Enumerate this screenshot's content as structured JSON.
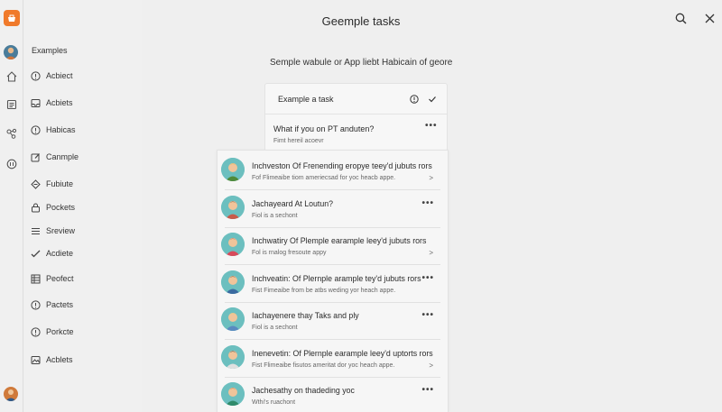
{
  "header": {
    "title": "Geemple tasks",
    "search_icon": "search-icon",
    "close_icon": "close-icon"
  },
  "rail": {
    "logo_icon": "app-logo-icon",
    "icons": [
      "home-icon",
      "document-icon",
      "share-icon",
      "chat-icon"
    ]
  },
  "sidebar": {
    "heading": "Examples",
    "items": [
      {
        "label": "Acbiect",
        "icon": "info-icon"
      },
      {
        "label": "Acbiets",
        "icon": "inbox-icon"
      },
      {
        "label": "Habicas",
        "icon": "info-icon"
      },
      {
        "label": "Canmple",
        "icon": "edit-icon"
      },
      {
        "label": "Fubiute",
        "icon": "diamond-icon"
      },
      {
        "label": "Pockets",
        "icon": "lock-icon"
      },
      {
        "label": "Sreview",
        "icon": "list-icon"
      },
      {
        "label": "Acdiete",
        "icon": "check-pen-icon"
      },
      {
        "label": "Peofect",
        "icon": "grid-icon"
      },
      {
        "label": "Pactets",
        "icon": "info-icon"
      },
      {
        "label": "Porkcte",
        "icon": "info-icon"
      },
      {
        "label": "Acblets",
        "icon": "image-icon"
      }
    ]
  },
  "main": {
    "subtitle": "Semple wabule or App liebt Habicain of geore",
    "task_card": {
      "example_label": "Example a task",
      "question": "What if you on PT anduten?",
      "sub": "Fimt hereil acoevr"
    },
    "list": [
      {
        "title": "Inchveston Of Frenending eropye teey'd jubuts rors",
        "sub": "Fof Flimeaibe tiom ameriecsad for yoc heacb appe.",
        "action": "chevron",
        "avatar_color": "#e9b84a",
        "shirt": "#4f8a3a"
      },
      {
        "title": "Jachayeard At Loutun?",
        "sub": "Fiol is a sechont",
        "action": "more",
        "avatar_color": "#8a5a3a",
        "shirt": "#c85a4a"
      },
      {
        "title": "Inchwatiry Of Plemple earample leey'd jubuts rors",
        "sub": "Fol is rnalog fresoute appy",
        "action": "chevron",
        "avatar_color": "#c9604a",
        "shirt": "#d84a5a"
      },
      {
        "title": "Inchveatin: Of Plernple arample tey'd jubuts rors",
        "sub": "Fist Fimeaibe from be atbs weding yor heach appe.",
        "action": "more",
        "avatar_color": "#7a4a2a",
        "shirt": "#3a6aa0"
      },
      {
        "title": "Iachayenere thay Taks and ply",
        "sub": "Fiol is a sechont",
        "action": "more",
        "avatar_color": "#f0d070",
        "shirt": "#5a8ac0"
      },
      {
        "title": "Inenevetin: Of Plernple earample leey'd uptorts rors",
        "sub": "Fist Flimeaibe fisutos ameritat dor yoc heach appe.",
        "action": "chevron",
        "avatar_color": "#3a3a3a",
        "shirt": "#e0e0e0"
      },
      {
        "title": "Jachesathy on thadeding yoc",
        "sub": "Wthi's ruachont",
        "action": "more",
        "avatar_color": "#d8703a",
        "shirt": "#2f8a6a"
      }
    ]
  }
}
